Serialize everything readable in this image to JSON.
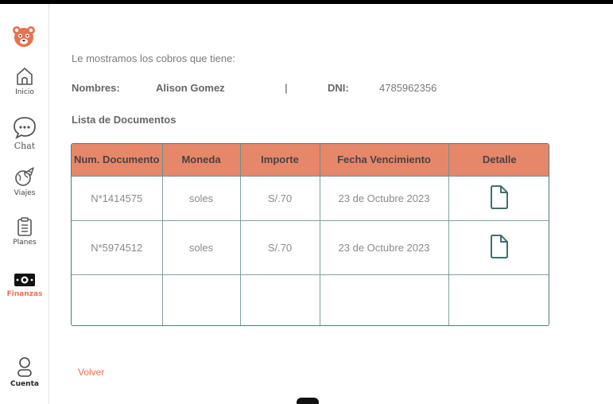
{
  "sidebar": {
    "items": [
      {
        "label": "Inicio"
      },
      {
        "label": "Chat"
      },
      {
        "label": "Viajes"
      },
      {
        "label": "Planes"
      },
      {
        "label": "Finanzas"
      },
      {
        "label": "Cuenta"
      }
    ],
    "active": "Finanzas",
    "accent": "#e8724f"
  },
  "main": {
    "intro": "Le mostramos los cobros que tiene:",
    "name_label": "Nombres:",
    "name_value": "Alison Gomez",
    "separator": "|",
    "dni_label": "DNI:",
    "dni_value": "4785962356",
    "docs_title": "Lista de Documentos",
    "back_label": "Volver"
  },
  "table": {
    "header_color": "#e7876a",
    "columns": [
      "Num. Documento",
      "Moneda",
      "Importe",
      "Fecha Vencimiento",
      "Detalle"
    ],
    "rows": [
      {
        "num": "N*1414575",
        "currency": "soles",
        "amount": "S/.70",
        "due": "23 de Octubre 2023",
        "detail_icon": "document-icon"
      },
      {
        "num": "N*5974512",
        "currency": "soles",
        "amount": "S/.70",
        "due": "23 de Octubre 2023",
        "detail_icon": "document-icon"
      }
    ]
  }
}
